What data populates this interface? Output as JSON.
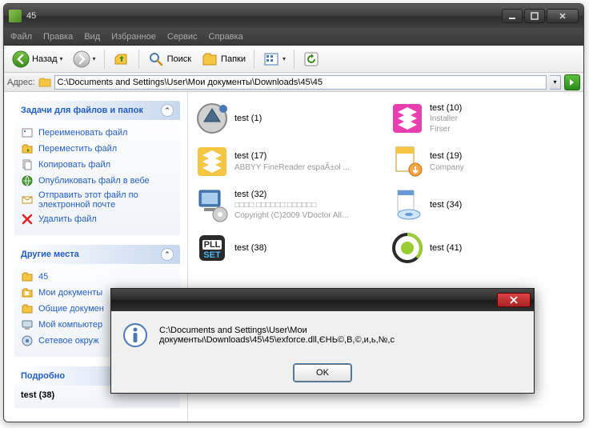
{
  "window": {
    "title": "45"
  },
  "menus": [
    "Файл",
    "Правка",
    "Вид",
    "Избранное",
    "Сервис",
    "Справка"
  ],
  "toolbar": {
    "back": "Назад",
    "search": "Поиск",
    "folders": "Папки"
  },
  "address": {
    "label": "Адрес:",
    "value": "C:\\Documents and Settings\\User\\Мои документы\\Downloads\\45\\45"
  },
  "sidebar": {
    "tasks": {
      "title": "Задачи для файлов и папок",
      "items": [
        "Переименовать файл",
        "Переместить файл",
        "Копировать файл",
        "Опубликовать файл в вебе",
        "Отправить этот файл по электронной почте",
        "Удалить файл"
      ]
    },
    "places": {
      "title": "Другие места",
      "items": [
        "45",
        "Мои документы",
        "Общие докумен",
        "Мой компьютер",
        "Сетевое окруж"
      ]
    },
    "details": {
      "title": "Подробно",
      "item": "test (38)"
    }
  },
  "files": [
    {
      "name": "test (1)",
      "sub1": "",
      "sub2": ""
    },
    {
      "name": "test (10)",
      "sub1": "Installer",
      "sub2": "Firser"
    },
    {
      "name": "test (17)",
      "sub1": "ABBYY FineReader espaÃ±ol ...",
      "sub2": ""
    },
    {
      "name": "test (19)",
      "sub1": "Company",
      "sub2": ""
    },
    {
      "name": "test (32)",
      "sub1": "□□□□ □□□□□□ □□□□□□",
      "sub2": "Copyright (C)2009 VDoctor All..."
    },
    {
      "name": "test (34)",
      "sub1": "",
      "sub2": ""
    },
    {
      "name": "test (38)",
      "sub1": "",
      "sub2": ""
    },
    {
      "name": "test (41)",
      "sub1": "",
      "sub2": ""
    }
  ],
  "dialog": {
    "message": "C:\\Documents and Settings\\User\\Мои документы\\Downloads\\45\\45\\exforce.dll,ЄНЬ©,В,©,и,ь,№,с",
    "ok": "OK"
  }
}
